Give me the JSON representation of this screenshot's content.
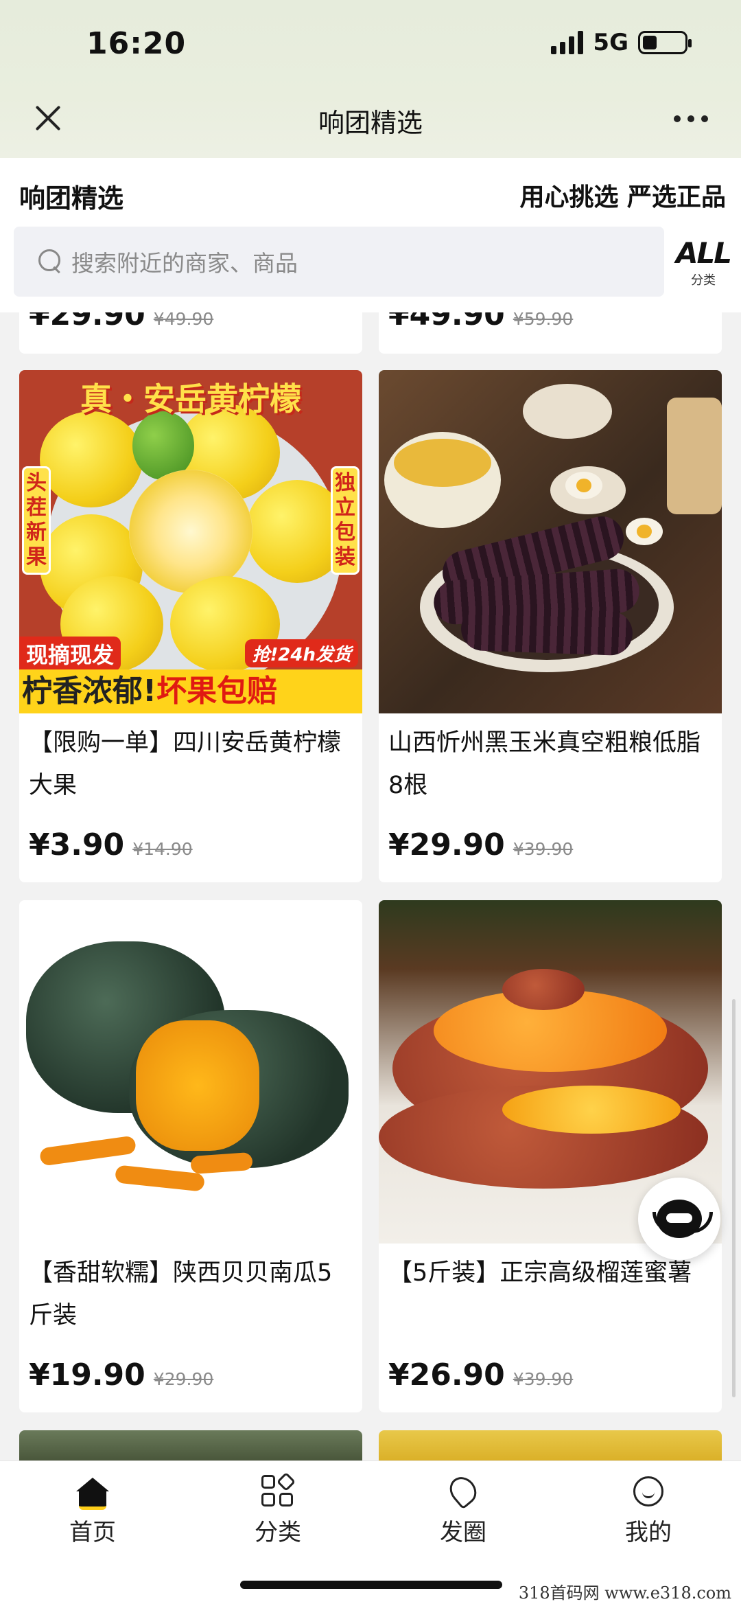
{
  "status_bar": {
    "time": "16:20",
    "network": "5G",
    "battery_level": 0.35
  },
  "nav": {
    "title": "响团精选"
  },
  "header": {
    "brand": "响团精选",
    "slogan": "用心挑选 严选正品",
    "search_placeholder": "搜索附近的商家、商品",
    "all_label": "ALL",
    "all_sub": "分类"
  },
  "feed": {
    "partial_top": [
      {
        "price": "¥29.90",
        "original_price": "¥49.90"
      },
      {
        "price": "¥49.90",
        "original_price": "¥59.90"
      }
    ],
    "products": [
      {
        "name": "【限购一单】四川安岳黄柠檬大果",
        "price": "¥3.90",
        "original_price": "¥14.90",
        "image_text": {
          "title": "真・安岳黄柠檬",
          "left_tag": "头茬新果",
          "right_tag": "独立包装",
          "banner_small": "现摘现发",
          "badge": "抢!24h发货",
          "banner_main_a": "柠香浓郁!",
          "banner_main_b": "坏果包赔"
        }
      },
      {
        "name": "山西忻州黑玉米真空粗粮低脂8根",
        "price": "¥29.90",
        "original_price": "¥39.90"
      },
      {
        "name": "【香甜软糯】陕西贝贝南瓜5斤装",
        "price": "¥19.90",
        "original_price": "¥29.90"
      },
      {
        "name": "【5斤装】正宗高级榴莲蜜薯",
        "price": "¥26.90",
        "original_price": "¥39.90"
      }
    ]
  },
  "tabs": [
    {
      "label": "首页",
      "icon": "home-icon"
    },
    {
      "label": "分类",
      "icon": "category-icon"
    },
    {
      "label": "发圈",
      "icon": "send-icon"
    },
    {
      "label": "我的",
      "icon": "profile-icon"
    }
  ],
  "watermark": "318首码网 www.e318.com"
}
